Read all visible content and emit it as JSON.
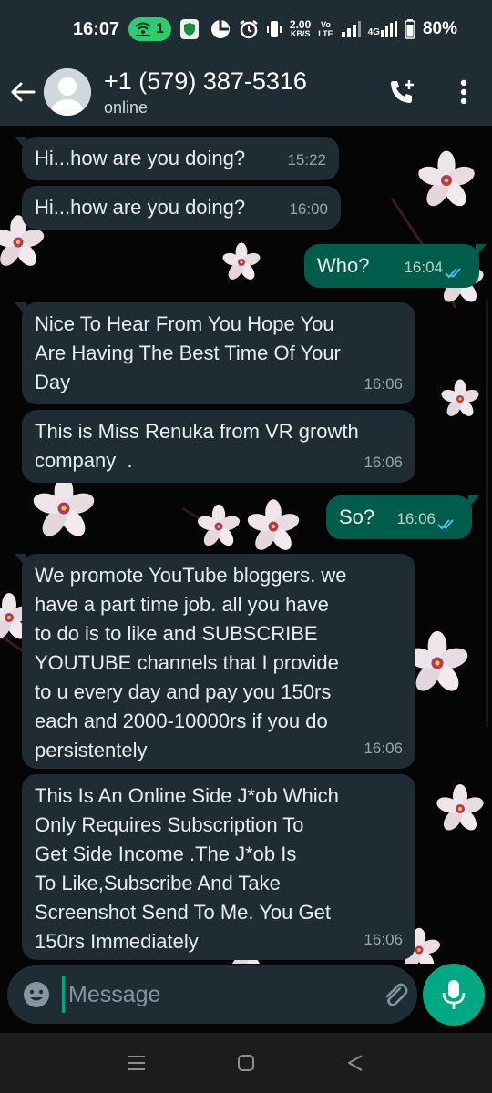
{
  "status_bar": {
    "time": "16:07",
    "hotspot_count": "1",
    "net_speed_value": "2.00",
    "net_speed_unit": "KB/S",
    "volte_top": "Vo",
    "volte_bottom": "LTE",
    "network_type": "4G",
    "battery": "80%"
  },
  "header": {
    "contact_name": "+1 (579) 387-5316",
    "status": "online",
    "back_icon": "arrow-left-icon",
    "call_icon": "add-call-icon",
    "menu_icon": "more-vertical-icon"
  },
  "messages": [
    {
      "direction": "in",
      "text": "Hi...how are you doing?",
      "time": "15:22"
    },
    {
      "direction": "in",
      "text": "Hi...how are you doing?",
      "time": "16:00"
    },
    {
      "direction": "out",
      "text": "Who?",
      "time": "16:04",
      "status": "read"
    },
    {
      "direction": "in",
      "text": "Nice To Hear From You Hope You\nAre Having The Best Time Of Your\nDay",
      "time": "16:06"
    },
    {
      "direction": "in",
      "text": "This is Miss Renuka from VR growth\ncompany  .",
      "time": "16:06"
    },
    {
      "direction": "out",
      "text": "So?",
      "time": "16:06",
      "status": "read"
    },
    {
      "direction": "in",
      "text": "We promote YouTube bloggers. we\nhave a part time job. all you have\nto do is to like and SUBSCRIBE\nYOUTUBE channels that I provide\nto u every day and pay you 150rs\neach and 2000-10000rs if you do\npersistentely",
      "time": "16:06"
    },
    {
      "direction": "in",
      "text": "This Is An Online Side J*ob Which\nOnly Requires Subscription To\nGet Side Income .The J*ob Is\nTo Like,Subscribe And Take\nScreenshot Send To Me. You Get\n150rs Immediately",
      "time": "16:06"
    }
  ],
  "input": {
    "placeholder": "Message",
    "emoji_icon": "emoji-icon",
    "attach_icon": "paperclip-icon",
    "camera_icon": "camera-icon",
    "mic_icon": "microphone-icon"
  },
  "nav_bar": {
    "recents_icon": "recents-icon",
    "home_icon": "home-icon",
    "back_icon": "back-triangle-icon"
  },
  "colors": {
    "header_bg": "#1f2c34",
    "incoming_bubble": "#1f2c34",
    "outgoing_bubble": "#005c4b",
    "accent": "#00a884",
    "read_ticks": "#53bdeb"
  }
}
